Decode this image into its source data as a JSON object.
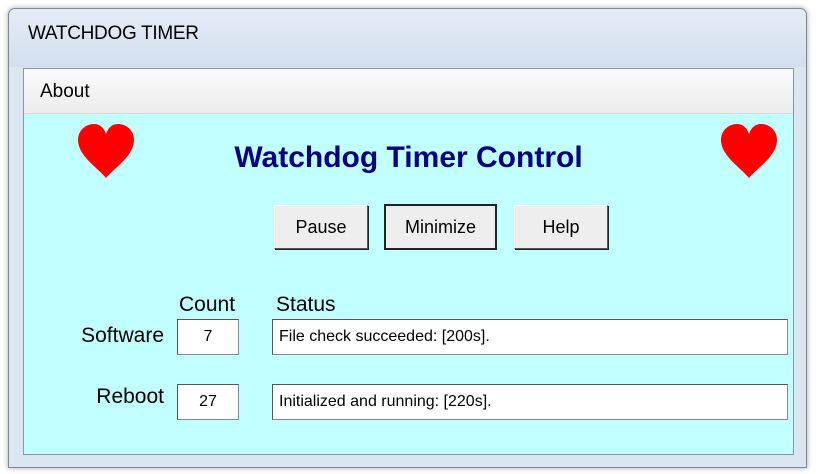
{
  "window": {
    "title": "WATCHDOG TIMER"
  },
  "menu": {
    "items": [
      {
        "label": "About"
      }
    ]
  },
  "main": {
    "heading": "Watchdog Timer Control",
    "buttons": {
      "pause": "Pause",
      "minimize": "Minimize",
      "help": "Help"
    },
    "columns": {
      "count": "Count",
      "status": "Status"
    },
    "rows": [
      {
        "label": "Software",
        "count": "7",
        "status": "File check succeeded: [200s]."
      },
      {
        "label": "Reboot",
        "count": "27",
        "status": "Initialized and running: [220s]."
      }
    ]
  },
  "colors": {
    "client_background": "#c2ffff",
    "heading": "#000080",
    "heart": "#ff0000"
  },
  "icons": {
    "left": "heart-icon",
    "right": "heart-icon"
  }
}
